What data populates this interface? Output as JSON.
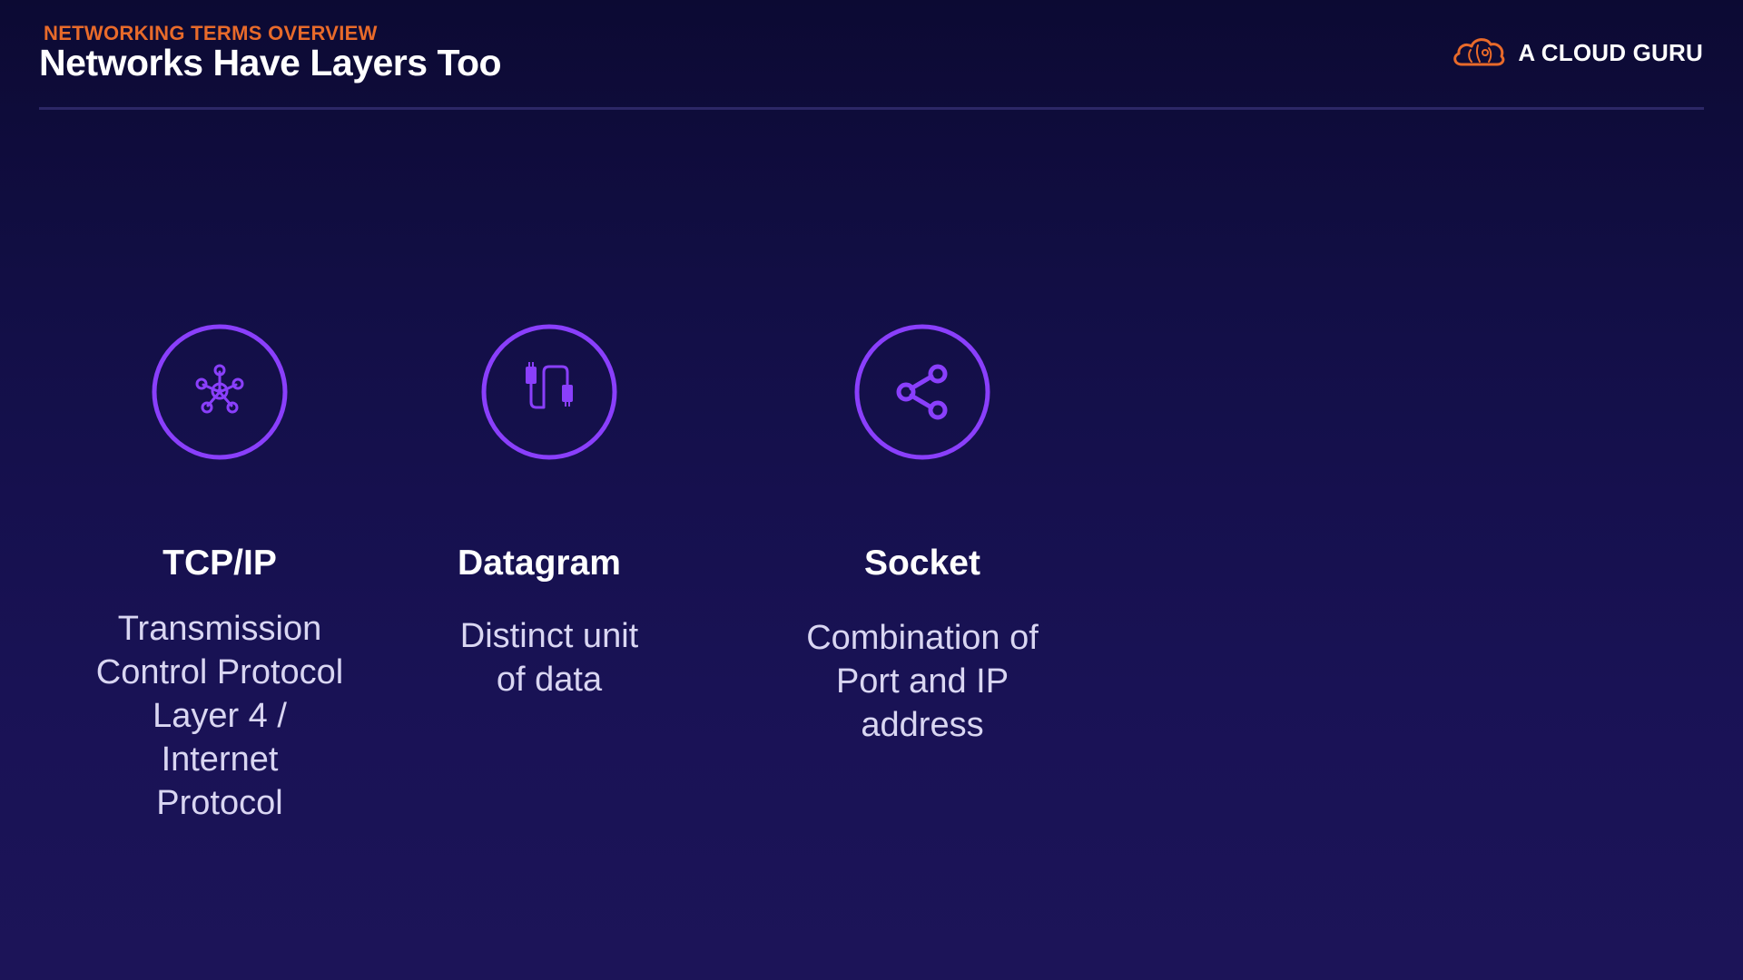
{
  "header": {
    "eyebrow": "NETWORKING TERMS OVERVIEW",
    "title": "Networks Have Layers Too"
  },
  "brand": {
    "name": "A CLOUD GURU",
    "logo_icon": "cloud-logo-icon",
    "logo_color": "#e86a2a"
  },
  "colors": {
    "accent_purple": "#8a3ffc",
    "eyebrow_orange": "#e86a2a",
    "background_top": "#0c0a33",
    "background_bottom": "#1c1458"
  },
  "terms": [
    {
      "icon": "network-hub-icon",
      "title": "TCP/IP",
      "description": "Transmission\nControl Protocol\nLayer 4 /\nInternet\nProtocol"
    },
    {
      "icon": "cable-connectors-icon",
      "title": "Datagram",
      "description": "Distinct unit\nof data"
    },
    {
      "icon": "share-icon",
      "title": "Socket",
      "description": "Combination of\nPort  and IP\naddress"
    }
  ]
}
